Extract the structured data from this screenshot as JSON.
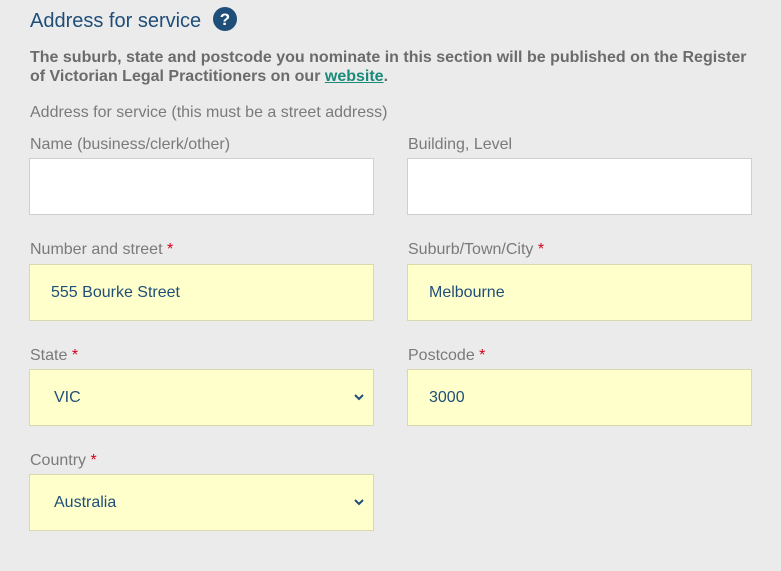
{
  "section": {
    "title": "Address for service",
    "help_icon": "question-circle-icon"
  },
  "intro": {
    "text_before": "The suburb, state and postcode you nominate in this section will be published on the Register of Victorian Legal Practitioners on our ",
    "link": "website",
    "text_after": "."
  },
  "subheading": "Address for service (this must be a street address)",
  "fields": {
    "name": {
      "label": "Name (business/clerk/other)",
      "value": ""
    },
    "building": {
      "label": "Building, Level",
      "value": ""
    },
    "street": {
      "label": "Number and street",
      "required": "*",
      "value": "555 Bourke Street"
    },
    "suburb": {
      "label": "Suburb/Town/City",
      "required": "*",
      "value": "Melbourne"
    },
    "state": {
      "label": "State",
      "required": "*",
      "value": "VIC"
    },
    "postcode": {
      "label": "Postcode",
      "required": "*",
      "value": "3000"
    },
    "country": {
      "label": "Country",
      "required": "*",
      "value": "Australia"
    }
  },
  "colors": {
    "title": "#1f4e79",
    "filled_bg": "#ffffcc",
    "required": "#d0021b",
    "link": "#1a8a7a"
  }
}
